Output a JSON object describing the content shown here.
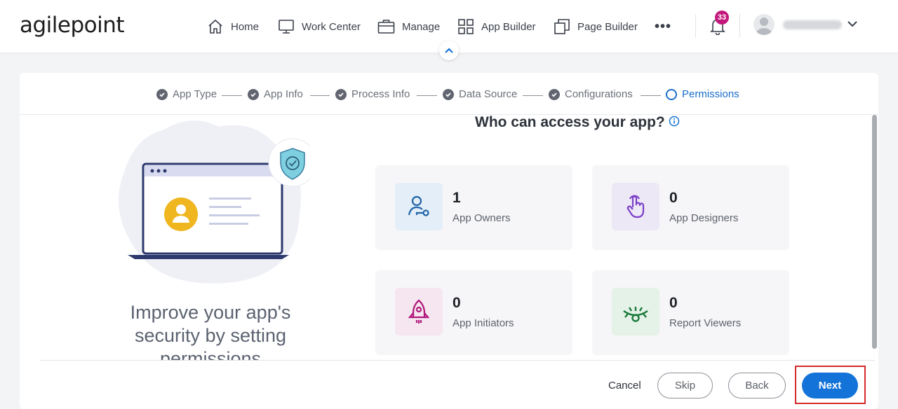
{
  "brand": {
    "logo_text": "agilepoint"
  },
  "nav": {
    "items": [
      {
        "label": "Home",
        "icon": "home-icon"
      },
      {
        "label": "Work Center",
        "icon": "monitor-icon"
      },
      {
        "label": "Manage",
        "icon": "briefcase-icon"
      },
      {
        "label": "App Builder",
        "icon": "grid-icon"
      },
      {
        "label": "Page Builder",
        "icon": "pages-icon"
      }
    ],
    "more": "•••",
    "notifications_count": "33"
  },
  "stepper": {
    "steps": [
      {
        "label": "App Type",
        "state": "complete"
      },
      {
        "label": "App Info",
        "state": "complete"
      },
      {
        "label": "Process Info",
        "state": "complete"
      },
      {
        "label": "Data Source",
        "state": "complete"
      },
      {
        "label": "Configurations",
        "state": "complete"
      },
      {
        "label": "Permissions",
        "state": "active"
      }
    ]
  },
  "main": {
    "heading": "Who can access your app?",
    "side_text": "Improve your app's security by setting permissions",
    "permissions": [
      {
        "count": "1",
        "label": "App Owners",
        "icon": "user-key-icon",
        "color": "#1e63a8",
        "bg": "#e4eef8"
      },
      {
        "count": "0",
        "label": "App Designers",
        "icon": "pointer-hand-icon",
        "color": "#7b3fc8",
        "bg": "#ede8f6"
      },
      {
        "count": "0",
        "label": "App Initiators",
        "icon": "rocket-icon",
        "color": "#b0177a",
        "bg": "#f5e6f0"
      },
      {
        "count": "0",
        "label": "Report Viewers",
        "icon": "eye-icon",
        "color": "#1a7a3a",
        "bg": "#e4f2e8"
      }
    ]
  },
  "footer": {
    "cancel_label": "Cancel",
    "skip_label": "Skip",
    "back_label": "Back",
    "next_label": "Next"
  },
  "colors": {
    "accent": "#1473d8",
    "highlight": "#d42a2a",
    "badge": "#c4177c"
  }
}
